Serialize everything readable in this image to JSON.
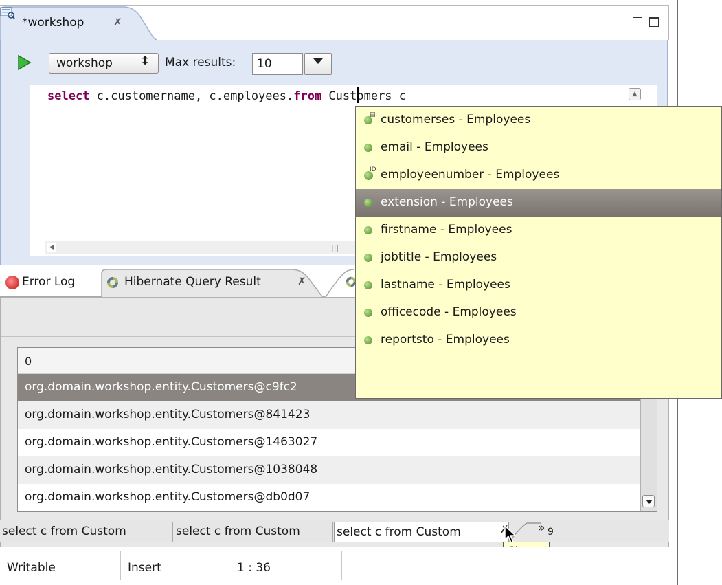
{
  "editor": {
    "tab_title": "*workshop",
    "tab_close_glyph": "✗",
    "config_combo_value": "workshop",
    "max_results_label": "Max results:",
    "max_results_value": "10",
    "query_parts": {
      "kw_select": "select",
      "middle": " c.customername, c.employees.",
      "kw_from": "from",
      "tail": " Customers c"
    }
  },
  "result_view": {
    "tabs": [
      {
        "label": "Error Log",
        "icon": "error-log-icon"
      },
      {
        "label": "Hibernate Query Result",
        "icon": "hibernate-icon",
        "active": true
      }
    ],
    "close_glyph": "✗",
    "table": {
      "header": "0",
      "rows": [
        "org.domain.workshop.entity.Customers@c9fc2",
        "org.domain.workshop.entity.Customers@841423",
        "org.domain.workshop.entity.Customers@1463027",
        "org.domain.workshop.entity.Customers@1038048",
        "org.domain.workshop.entity.Customers@db0d07"
      ],
      "selected_row_index": 0
    },
    "query_tabs": [
      "select c from Custom",
      "select c from Custom",
      "select c from Custom"
    ],
    "query_tabs_overflow": "»",
    "query_tabs_overflow_count": "9",
    "tooltip": "Close"
  },
  "autocomplete": {
    "items": [
      {
        "label": "customerses - Employees",
        "icon": "collection-property-icon"
      },
      {
        "label": "email - Employees",
        "icon": "property-icon"
      },
      {
        "label": "employeenumber - Employees",
        "icon": "identifier-property-icon"
      },
      {
        "label": "extension - Employees",
        "icon": "property-icon"
      },
      {
        "label": "firstname - Employees",
        "icon": "property-icon"
      },
      {
        "label": "jobtitle - Employees",
        "icon": "property-icon"
      },
      {
        "label": "lastname - Employees",
        "icon": "property-icon"
      },
      {
        "label": "officecode - Employees",
        "icon": "property-icon"
      },
      {
        "label": "reportsto - Employees",
        "icon": "property-icon"
      }
    ],
    "selected_index": 3
  },
  "status_bar": {
    "mode": "Writable",
    "insert": "Insert",
    "position": "1 : 36"
  },
  "colors": {
    "editor_bg": "#dfe8f4",
    "keyword": "#7f0055",
    "popup_bg": "#ffffcc",
    "selection": "#8a8580"
  }
}
